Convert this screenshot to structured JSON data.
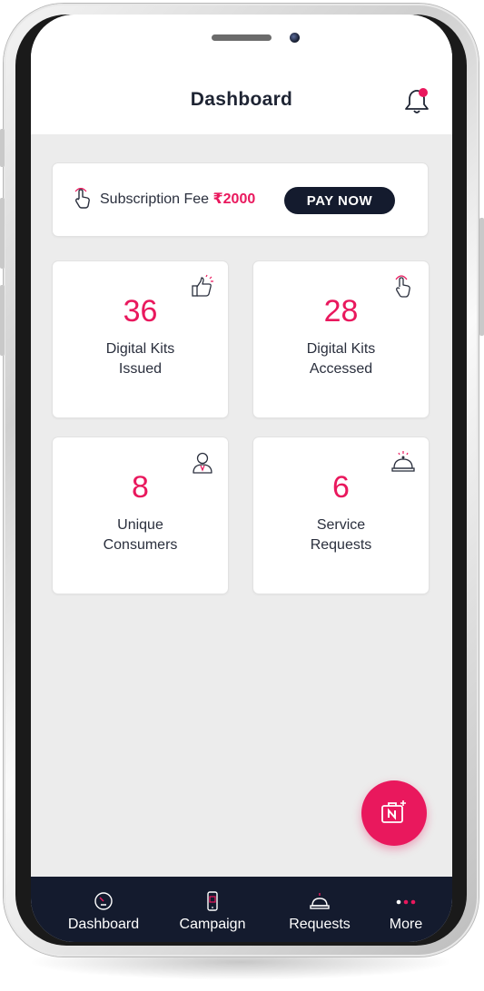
{
  "header": {
    "title": "Dashboard",
    "notification_icon": "bell-icon",
    "notification_dot_color": "#e9185d"
  },
  "subscription": {
    "label": "Subscription Fee",
    "amount": "₹2000",
    "pay_button": "PAY NOW",
    "icon": "tap-hand-icon"
  },
  "stats": [
    {
      "value": "36",
      "label": "Digital Kits\nIssued",
      "icon": "thumbs-up-icon"
    },
    {
      "value": "28",
      "label": "Digital Kits\nAccessed",
      "icon": "tap-hand-icon"
    },
    {
      "value": "8",
      "label": "Unique\nConsumers",
      "icon": "user-icon"
    },
    {
      "value": "6",
      "label": "Service\nRequests",
      "icon": "service-bell-icon"
    }
  ],
  "fab": {
    "icon": "add-kit-icon"
  },
  "nav": [
    {
      "label": "Dashboard",
      "icon": "gauge-icon"
    },
    {
      "label": "Campaign",
      "icon": "mobile-icon"
    },
    {
      "label": "Requests",
      "icon": "service-bell-icon"
    },
    {
      "label": "More",
      "icon": "dots-icon"
    }
  ],
  "colors": {
    "accent": "#e9185d",
    "navy": "#141b2e",
    "background": "#ececec"
  }
}
